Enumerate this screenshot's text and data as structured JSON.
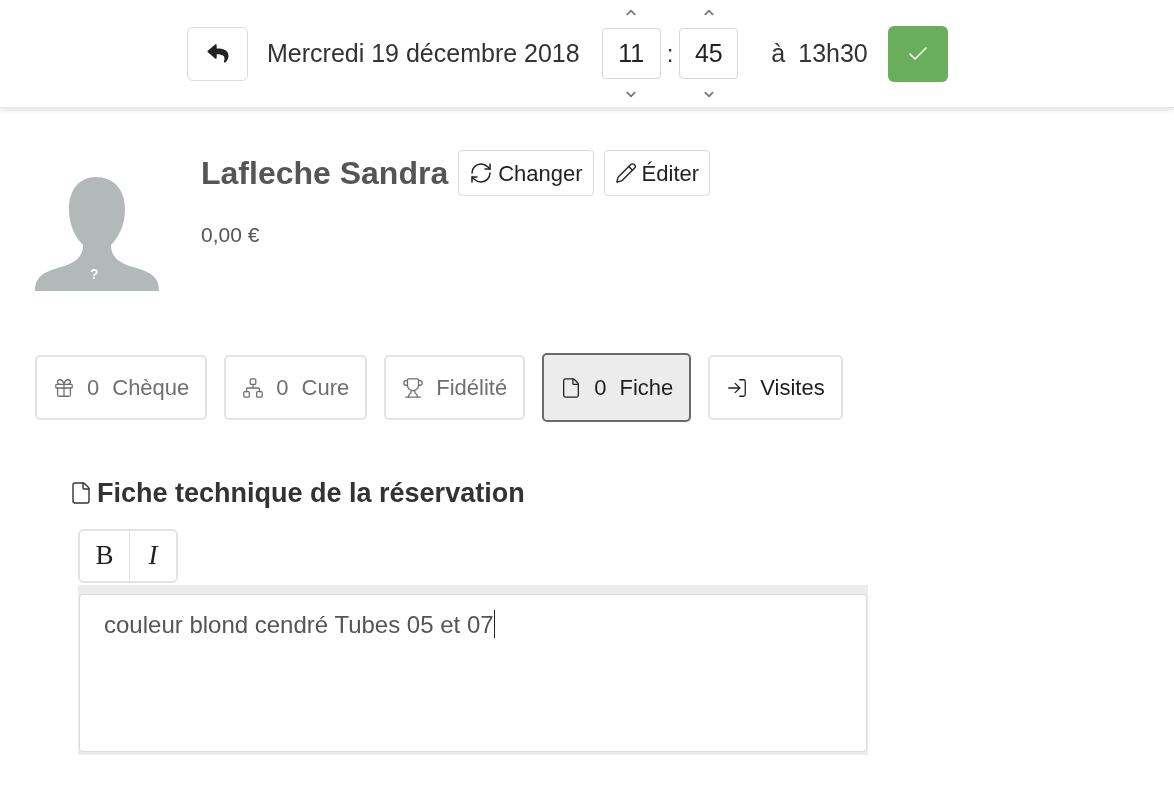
{
  "header": {
    "date": "Mercredi 19 décembre 2018",
    "start_hour": "11",
    "time_separator": ":",
    "start_minute": "45",
    "end_prefix": "à",
    "end_time": "13h30"
  },
  "client": {
    "avatar_mark": "?",
    "name": "Lafleche Sandra",
    "actions": [
      "Changer",
      "Éditer"
    ],
    "balance": "0,00 €"
  },
  "tabs": [
    {
      "count": "0",
      "label": "Chèque",
      "selected": false,
      "dimmed": true
    },
    {
      "count": "0",
      "label": "Cure",
      "selected": false,
      "dimmed": true
    },
    {
      "label": "Fidélité",
      "selected": false,
      "dimmed": true
    },
    {
      "count": "0",
      "label": "Fiche",
      "selected": true,
      "dimmed": false
    },
    {
      "label": "Visites",
      "selected": false,
      "dimmed": false
    }
  ],
  "sheet": {
    "title": "Fiche technique de la réservation",
    "format_buttons": [
      "B",
      "I"
    ],
    "content": "couleur blond cendré Tubes 05 et 07",
    "focused": true
  }
}
